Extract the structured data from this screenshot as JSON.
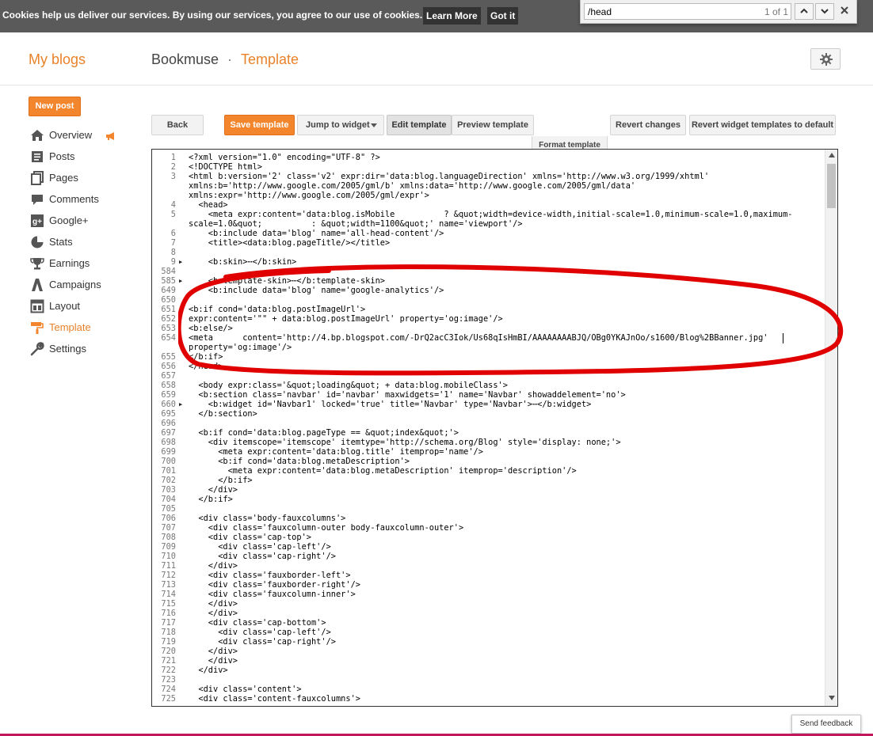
{
  "cookie_bar": {
    "message": "Cookies help us deliver our services. By using our services, you agree to our use of cookies.",
    "learn_more": "Learn More",
    "got_it": "Got it"
  },
  "find_bar": {
    "query": "/head",
    "count": "1 of 1",
    "prev_icon": "chevron-up-icon",
    "next_icon": "chevron-down-icon",
    "close_icon": "close-icon"
  },
  "header": {
    "my_blogs": "My blogs",
    "blog_name": "Bookmuse",
    "separator": "·",
    "section": "Template"
  },
  "sidebar": {
    "new_post": "New post",
    "items": [
      {
        "label": "Overview",
        "icon": "home-icon"
      },
      {
        "label": "Posts",
        "icon": "posts-icon"
      },
      {
        "label": "Pages",
        "icon": "pages-icon"
      },
      {
        "label": "Comments",
        "icon": "comments-icon"
      },
      {
        "label": "Google+",
        "icon": "google-plus-icon"
      },
      {
        "label": "Stats",
        "icon": "stats-icon"
      },
      {
        "label": "Earnings",
        "icon": "trophy-icon"
      },
      {
        "label": "Campaigns",
        "icon": "campaigns-icon"
      },
      {
        "label": "Layout",
        "icon": "layout-icon"
      },
      {
        "label": "Template",
        "icon": "paint-roller-icon",
        "active": true
      },
      {
        "label": "Settings",
        "icon": "wrench-icon"
      }
    ]
  },
  "toolbar": {
    "back": "Back",
    "save_template": "Save template",
    "jump_to_widget": "Jump to widget",
    "edit_template": "Edit template",
    "preview_template": "Preview template",
    "format_template": "Format template",
    "revert_changes": "Revert changes",
    "revert_widgets": "Revert widget templates to default"
  },
  "accent_color": "#f3852d",
  "annotation_color": "#e00000",
  "editor": {
    "lines": [
      {
        "n": "1",
        "t": "<?xml version=\"1.0\" encoding=\"UTF-8\" ?>"
      },
      {
        "n": "2",
        "t": "<!DOCTYPE html>"
      },
      {
        "n": "3",
        "t": "<html b:version='2' class='v2' expr:dir='data:blog.languageDirection' xmlns='http://www.w3.org/1999/xhtml'"
      },
      {
        "n": "",
        "t": "xmlns:b='http://www.google.com/2005/gml/b' xmlns:data='http://www.google.com/2005/gml/data'"
      },
      {
        "n": "",
        "t": "xmlns:expr='http://www.google.com/2005/gml/expr'>"
      },
      {
        "n": "4",
        "t": "  <head>"
      },
      {
        "n": "5",
        "t": "    <meta expr:content='data:blog.isMobile          ? &quot;width=device-width,initial-scale=1.0,minimum-scale=1.0,maximum-"
      },
      {
        "n": "",
        "t": "scale=1.0&quot;          : &quot;width=1100&quot;' name='viewport'/>"
      },
      {
        "n": "6",
        "t": "    <b:include data='blog' name='all-head-content'/>"
      },
      {
        "n": "7",
        "t": "    <title><data:blog.pageTitle/></title>"
      },
      {
        "n": "8",
        "t": ""
      },
      {
        "n": "9",
        "t": "    <b:skin>⋯</b:skin>",
        "fold": true
      },
      {
        "n": "584",
        "t": ""
      },
      {
        "n": "585",
        "t": "    <b:template-skin>⋯</b:template-skin>",
        "fold": true
      },
      {
        "n": "649",
        "t": "    <b:include data='blog' name='google-analytics'/>"
      },
      {
        "n": "650",
        "t": ""
      },
      {
        "n": "651",
        "t": "<b:if cond='data:blog.postImageUrl'>"
      },
      {
        "n": "652",
        "t": "expr:content='\"\" + data:blog.postImageUrl' property='og:image'/>"
      },
      {
        "n": "653",
        "t": "<b:else/>"
      },
      {
        "n": "654",
        "t": "<meta      content='http://4.bp.blogspot.com/-DrQ2acC3Iok/Us68qIsHmBI/AAAAAAAABJQ/OBg0YKAJnOo/s1600/Blog%2BBanner.jpg'"
      },
      {
        "n": "",
        "t": "property='og:image'/>"
      },
      {
        "n": "655",
        "t": "</b:if>"
      },
      {
        "n": "656",
        "t": "</head>"
      },
      {
        "n": "657",
        "t": ""
      },
      {
        "n": "658",
        "t": "  <body expr:class='&quot;loading&quot; + data:blog.mobileClass'>"
      },
      {
        "n": "659",
        "t": "  <b:section class='navbar' id='navbar' maxwidgets='1' name='Navbar' showaddelement='no'>"
      },
      {
        "n": "660",
        "t": "    <b:widget id='Navbar1' locked='true' title='Navbar' type='Navbar'>⋯</b:widget>",
        "fold": true
      },
      {
        "n": "695",
        "t": "  </b:section>"
      },
      {
        "n": "696",
        "t": ""
      },
      {
        "n": "697",
        "t": "  <b:if cond='data:blog.pageType == &quot;index&quot;'>"
      },
      {
        "n": "698",
        "t": "    <div itemscope='itemscope' itemtype='http://schema.org/Blog' style='display: none;'>"
      },
      {
        "n": "699",
        "t": "      <meta expr:content='data:blog.title' itemprop='name'/>"
      },
      {
        "n": "700",
        "t": "      <b:if cond='data:blog.metaDescription'>"
      },
      {
        "n": "701",
        "t": "        <meta expr:content='data:blog.metaDescription' itemprop='description'/>"
      },
      {
        "n": "702",
        "t": "      </b:if>"
      },
      {
        "n": "703",
        "t": "    </div>"
      },
      {
        "n": "704",
        "t": "  </b:if>"
      },
      {
        "n": "705",
        "t": ""
      },
      {
        "n": "706",
        "t": "  <div class='body-fauxcolumns'>"
      },
      {
        "n": "707",
        "t": "    <div class='fauxcolumn-outer body-fauxcolumn-outer'>"
      },
      {
        "n": "708",
        "t": "    <div class='cap-top'>"
      },
      {
        "n": "709",
        "t": "      <div class='cap-left'/>"
      },
      {
        "n": "710",
        "t": "      <div class='cap-right'/>"
      },
      {
        "n": "711",
        "t": "    </div>"
      },
      {
        "n": "712",
        "t": "    <div class='fauxborder-left'>"
      },
      {
        "n": "713",
        "t": "    <div class='fauxborder-right'/>"
      },
      {
        "n": "714",
        "t": "    <div class='fauxcolumn-inner'>"
      },
      {
        "n": "715",
        "t": "    </div>"
      },
      {
        "n": "716",
        "t": "    </div>"
      },
      {
        "n": "717",
        "t": "    <div class='cap-bottom'>"
      },
      {
        "n": "718",
        "t": "      <div class='cap-left'/>"
      },
      {
        "n": "719",
        "t": "      <div class='cap-right'/>"
      },
      {
        "n": "720",
        "t": "    </div>"
      },
      {
        "n": "721",
        "t": "    </div>"
      },
      {
        "n": "722",
        "t": "  </div>"
      },
      {
        "n": "723",
        "t": ""
      },
      {
        "n": "724",
        "t": "  <div class='content'>"
      },
      {
        "n": "725",
        "t": "  <div class='content-fauxcolumns'>"
      }
    ]
  },
  "send_feedback": "Send feedback"
}
